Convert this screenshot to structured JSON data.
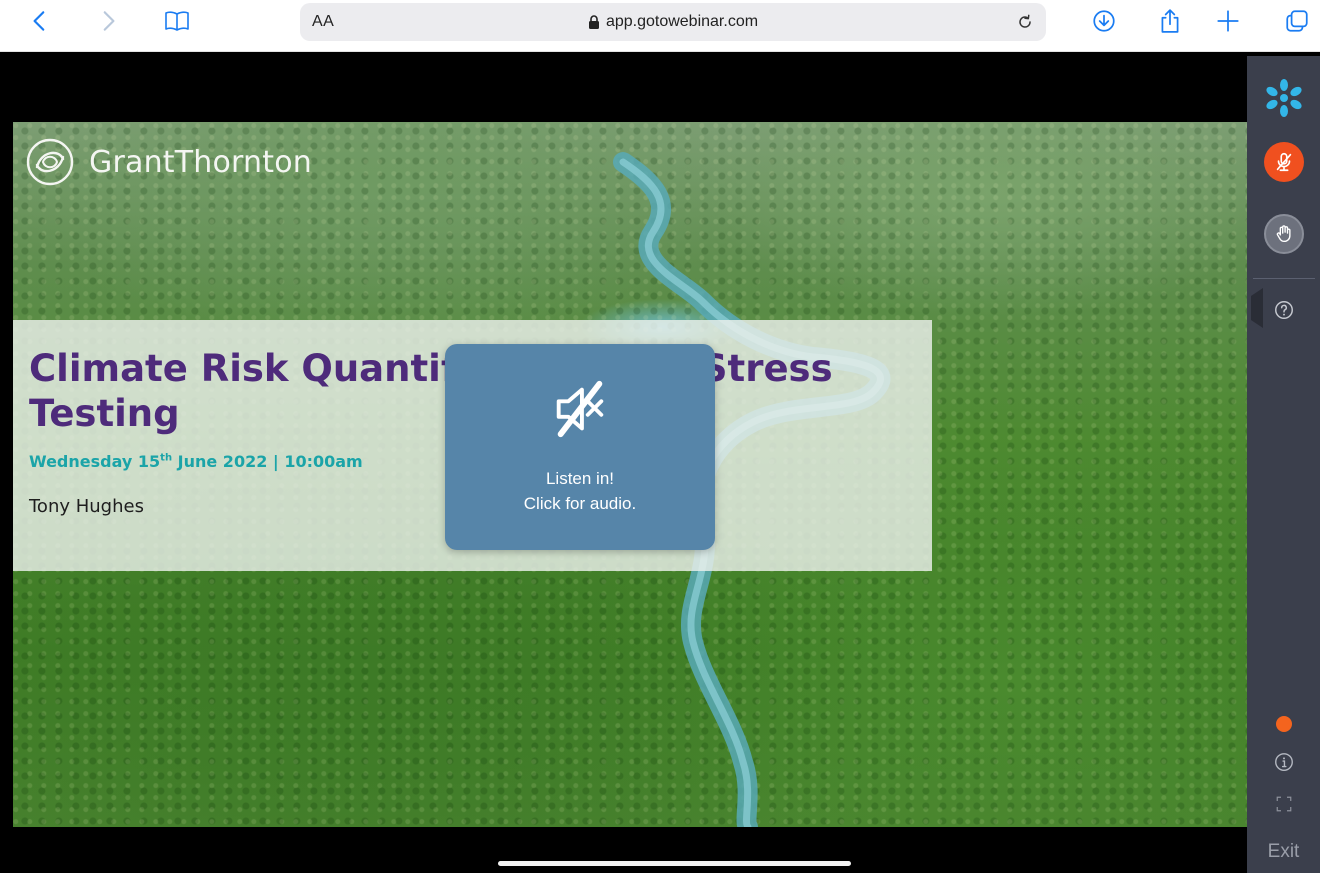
{
  "browser": {
    "text_size_label": "AA",
    "url": "app.gotowebinar.com",
    "icons": {
      "back": "chevron-left-icon",
      "forward": "chevron-right-icon",
      "bookmarks": "book-icon",
      "reload": "reload-icon",
      "download": "download-icon",
      "share": "share-icon",
      "new_tab": "plus-icon",
      "tabs": "tabs-icon"
    },
    "accent_color": "#1a7cf2"
  },
  "slide": {
    "logo_text": "GrantThornton",
    "title": "Climate Risk Quantification and Stress Testing",
    "date_day": "Wednesday 15",
    "date_suffix": "th",
    "date_rest": " June 2022 | 10:00am",
    "presenter": "Tony Hughes",
    "title_color": "#4e2b7b",
    "subtitle_color": "#1ba4a8"
  },
  "audio_popup": {
    "icon": "speaker-muted-icon",
    "line1": "Listen in!",
    "line2": "Click for audio."
  },
  "control_panel": {
    "logo_icon": "gotowebinar-snowflake-icon",
    "mic_icon": "microphone-muted-icon",
    "hand_icon": "raise-hand-icon",
    "help_icon": "question-icon",
    "info_icon": "info-icon",
    "fullscreen_icon": "fullscreen-icon",
    "exit_label": "Exit",
    "mic_color": "#f0501f",
    "status_color": "#f4641e"
  }
}
